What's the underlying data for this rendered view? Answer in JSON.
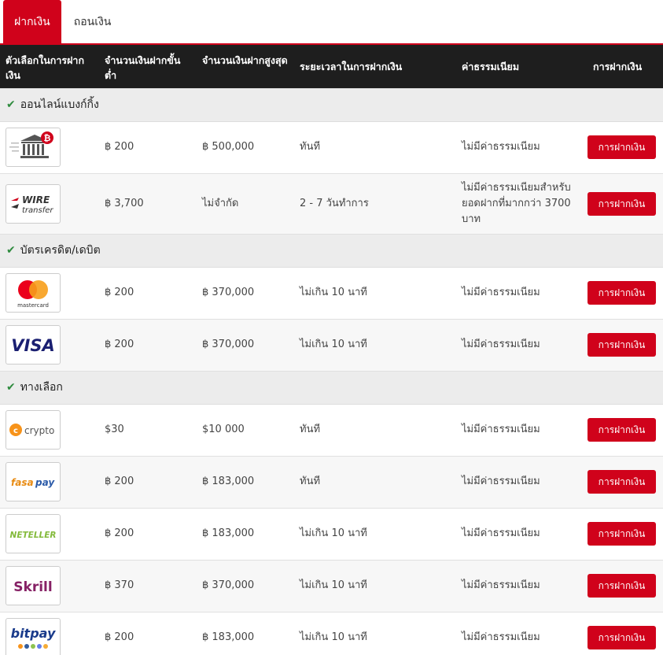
{
  "tabs": [
    {
      "label": "ฝากเงิน",
      "active": true
    },
    {
      "label": "ถอนเงิน",
      "active": false
    }
  ],
  "headers": {
    "option": "ตัวเลือกในการฝากเงิน",
    "min": "จำนวนเงินฝากขั้นต่ำ",
    "max": "จำนวนเงินฝากสูงสุด",
    "time": "ระยะเวลาในการฝากเงิน",
    "fee": "ค่าธรรมเนียม",
    "action": "การฝากเงิน"
  },
  "colors": {
    "accent": "#d0021b",
    "check": "#2e8b3e",
    "header_bg": "#1e1e1e"
  },
  "categories": [
    {
      "name": "ออนไลน์แบงก์กิ้ง"
    },
    {
      "name": "บัตรเครดิต/เดบิต"
    },
    {
      "name": "ทางเลือก"
    }
  ],
  "rows": [
    {
      "logo": "bank-bitcoin-icon",
      "min": "฿ 200",
      "max": "฿ 500,000",
      "time": "ทันที",
      "fee": "ไม่มีค่าธรรมเนียม",
      "button": "การฝากเงิน"
    },
    {
      "logo": "wire-transfer-logo",
      "logo_text1": "WIRE",
      "logo_text2": "transfer",
      "min": "฿ 3,700",
      "max": "ไม่จำกัด",
      "time": "2 - 7 วันทำการ",
      "fee": "ไม่มีค่าธรรมเนียมสำหรับยอดฝากที่มากกว่า 3700 บาท",
      "button": "การฝากเงิน"
    },
    {
      "logo": "mastercard-logo",
      "logo_text": "mastercard",
      "min": "฿ 200",
      "max": "฿ 370,000",
      "time": "ไม่เกิน 10 นาที",
      "fee": "ไม่มีค่าธรรมเนียม",
      "button": "การฝากเงิน"
    },
    {
      "logo": "visa-logo",
      "logo_text": "VISA",
      "min": "฿ 200",
      "max": "฿ 370,000",
      "time": "ไม่เกิน 10 นาที",
      "fee": "ไม่มีค่าธรรมเนียม",
      "button": "การฝากเงิน"
    },
    {
      "logo": "crypto-logo",
      "logo_text": "crypto",
      "min": "$30",
      "max": "$10 000",
      "time": "ทันที",
      "fee": "ไม่มีค่าธรรมเนียม",
      "button": "การฝากเงิน"
    },
    {
      "logo": "fasapay-logo",
      "logo_text1": "fasa",
      "logo_text2": "pay",
      "min": "฿ 200",
      "max": "฿ 183,000",
      "time": "ทันที",
      "fee": "ไม่มีค่าธรรมเนียม",
      "button": "การฝากเงิน"
    },
    {
      "logo": "neteller-logo",
      "logo_text": "NETELLER",
      "min": "฿ 200",
      "max": "฿ 183,000",
      "time": "ไม่เกิน 10 นาที",
      "fee": "ไม่มีค่าธรรมเนียม",
      "button": "การฝากเงิน"
    },
    {
      "logo": "skrill-logo",
      "logo_text": "Skrill",
      "min": "฿ 370",
      "max": "฿ 370,000",
      "time": "ไม่เกิน 10 นาที",
      "fee": "ไม่มีค่าธรรมเนียม",
      "button": "การฝากเงิน"
    },
    {
      "logo": "bitpay-logo",
      "logo_text": "bitpay",
      "min": "฿ 200",
      "max": "฿ 183,000",
      "time": "ไม่เกิน 10 นาที",
      "fee": "ไม่มีค่าธรรมเนียม",
      "button": "การฝากเงิน"
    }
  ]
}
